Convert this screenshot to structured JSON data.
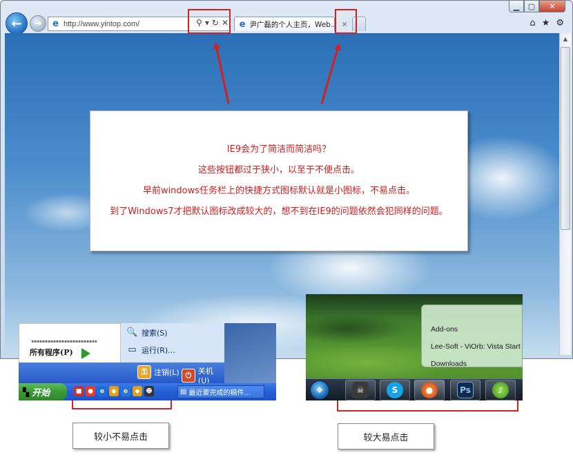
{
  "browser": {
    "url": "http://www.yintop.com/",
    "tab_title": "尹广磊的个人主页，Web...",
    "address_tools": {
      "search": "⚲",
      "dropdown": "▾",
      "refresh": "↻",
      "stop": "✕"
    },
    "tab_close": "✕",
    "window_controls": {
      "minimize": "▁",
      "maximize": "▢",
      "close": "✕"
    },
    "toolbar_icons": [
      "home-icon",
      "favorites-icon",
      "tools-gear-icon"
    ]
  },
  "callout": {
    "lines": [
      "IE9会为了简洁而简洁吗？",
      "这些按钮都过于狭小，以至于不便点击。",
      "早前windows任务栏上的快捷方式图标默认就是小图标，不易点击。",
      "到了Windows7才把默认图标改成较大的，想不到在IE9的问题依然会犯同样的问题。"
    ],
    "text_color": "#d11d1d"
  },
  "xp": {
    "all_programs": "所有程序(P)",
    "search": "搜索(S)",
    "run": "运行(R)...",
    "logoff": "注销(L)",
    "shutdown": "关机(U)",
    "start": "开始",
    "task_button": "最近要完成的稿件..."
  },
  "win7": {
    "jumplist": [
      "Add-ons",
      "Lee-Soft - ViOrb: Vista Start O",
      "Downloads"
    ],
    "taskbar_apps": [
      "alien-icon",
      "skype-icon",
      "firefox-icon",
      "photoshop-icon",
      "media-player-icon"
    ],
    "photoshop_label": "Ps"
  },
  "captions": {
    "small": "较小不易点击",
    "large": "较大易点击"
  },
  "colors": {
    "highlight": "#d42020",
    "accent_text": "#d11d1d"
  }
}
